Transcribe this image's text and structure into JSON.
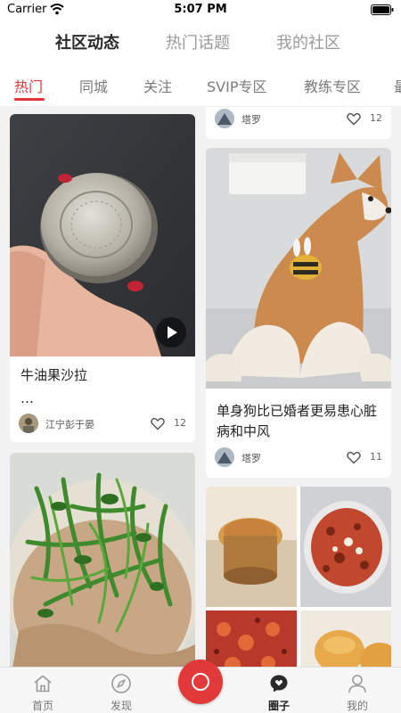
{
  "status": {
    "carrier": "Carrier",
    "time": "5:07 PM"
  },
  "top_tabs": [
    {
      "label": "社区动态",
      "active": true
    },
    {
      "label": "热门话题",
      "active": false
    },
    {
      "label": "我的社区",
      "active": false
    }
  ],
  "categories": [
    {
      "label": "热门",
      "active": true
    },
    {
      "label": "同城",
      "active": false
    },
    {
      "label": "关注",
      "active": false
    },
    {
      "label": "SVIP专区",
      "active": false
    },
    {
      "label": "教练专区",
      "active": false
    },
    {
      "label": "最",
      "active": false
    }
  ],
  "feed": {
    "left": [
      {
        "title": "牛油果沙拉",
        "excerpt": "…",
        "author": "江宁彭于晏",
        "likes": "12",
        "media": "video",
        "image_desc": "hand-holding-jar-image"
      },
      {
        "title": "",
        "author": "",
        "likes": "",
        "image_desc": "green-vegetable-noodles-image"
      }
    ],
    "right": [
      {
        "title": "",
        "author": "塔罗",
        "likes": "12"
      },
      {
        "title": "单身狗比已婚者更易患心脏病和中风",
        "author": "塔罗",
        "likes": "11",
        "image_desc": "corgi-dog-image"
      },
      {
        "title": "",
        "author": "",
        "likes": "",
        "image_desc": "food-collage-image"
      }
    ]
  },
  "bottom_nav": [
    {
      "label": "首页",
      "icon": "home-icon",
      "active": false
    },
    {
      "label": "发现",
      "icon": "compass-icon",
      "active": false
    },
    {
      "label": "",
      "icon": "camera-icon",
      "active": false
    },
    {
      "label": "圈子",
      "icon": "chat-bubble-icon",
      "active": true
    },
    {
      "label": "我的",
      "icon": "profile-icon",
      "active": false
    }
  ],
  "colors": {
    "accent": "#e33535",
    "camera_button": "#e23a3a",
    "background": "#f2f2f2"
  }
}
